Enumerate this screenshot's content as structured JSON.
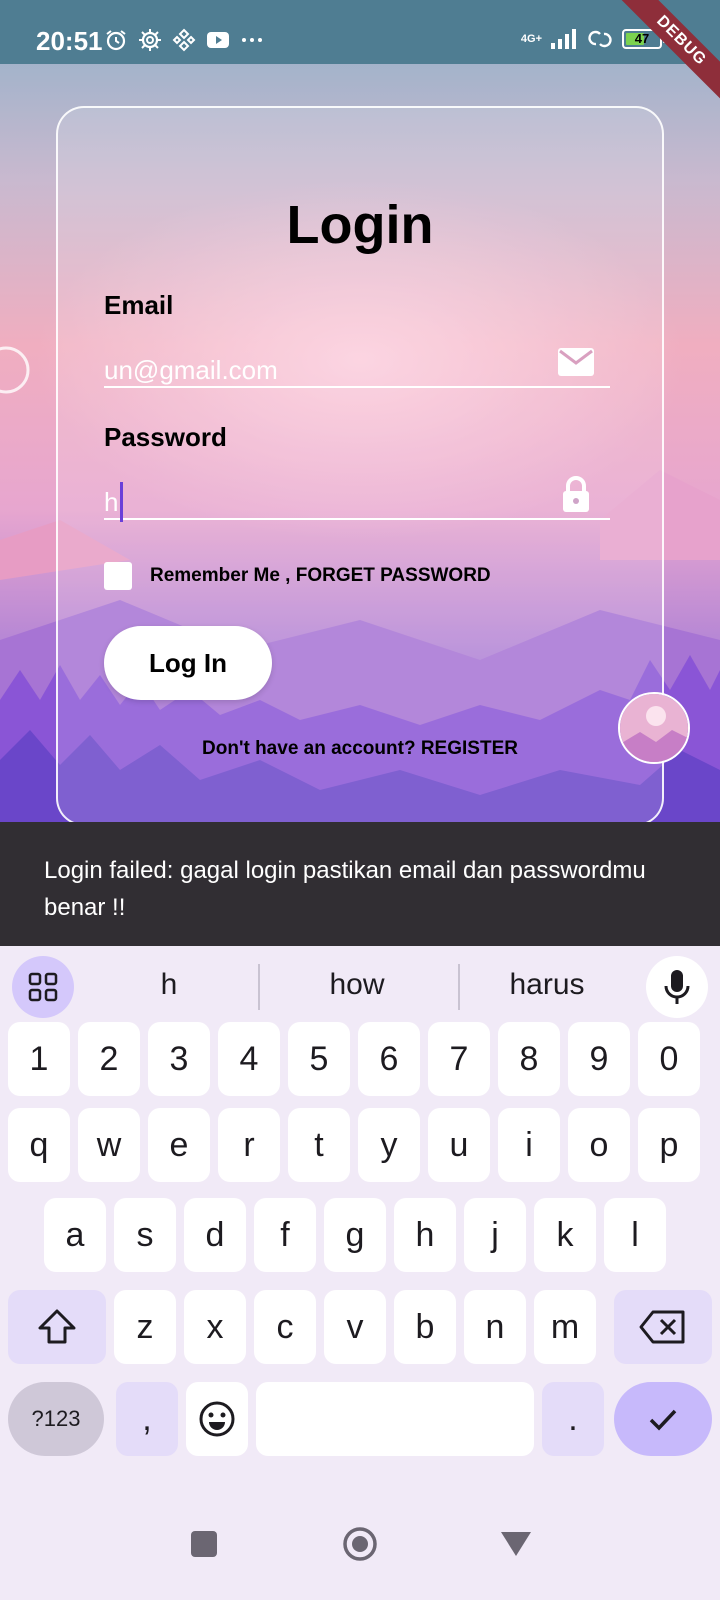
{
  "status_bar": {
    "time": "20:51",
    "network": "4G+",
    "battery": "47",
    "debug_banner": "DEBUG",
    "icons": [
      "alarm-icon",
      "settings-gear-icon",
      "binance-icon",
      "youtube-icon",
      "more-dots-icon",
      "signal-icon",
      "link-icon",
      "battery-icon"
    ]
  },
  "login": {
    "title": "Login",
    "email_label": "Email",
    "email_value": "un@gmail.com",
    "password_label": "Password",
    "password_value": "h",
    "remember_text": "Remember Me , FORGET PASSWORD",
    "login_button": "Log In",
    "register_text": "Don't have an account? REGISTER"
  },
  "snackbar": {
    "message": "Login failed: gagal login pastikan email dan passwordmu benar !!"
  },
  "keyboard": {
    "suggestions": [
      "h",
      "how",
      "harus"
    ],
    "row_numbers": [
      "1",
      "2",
      "3",
      "4",
      "5",
      "6",
      "7",
      "8",
      "9",
      "0"
    ],
    "row_top": [
      "q",
      "w",
      "e",
      "r",
      "t",
      "y",
      "u",
      "i",
      "o",
      "p"
    ],
    "row_middle": [
      "a",
      "s",
      "d",
      "f",
      "g",
      "h",
      "j",
      "k",
      "l"
    ],
    "row_bottom": [
      "z",
      "x",
      "c",
      "v",
      "b",
      "n",
      "m"
    ],
    "symbols_key": "?123",
    "comma_key": ",",
    "period_key": "."
  },
  "colors": {
    "status_bar": "#4f7d92",
    "snackbar": "#312e33",
    "keyboard_bg": "#f1eaf7",
    "keyboard_accent": "#c7b9fb",
    "text_caret": "#6a3fd9"
  }
}
